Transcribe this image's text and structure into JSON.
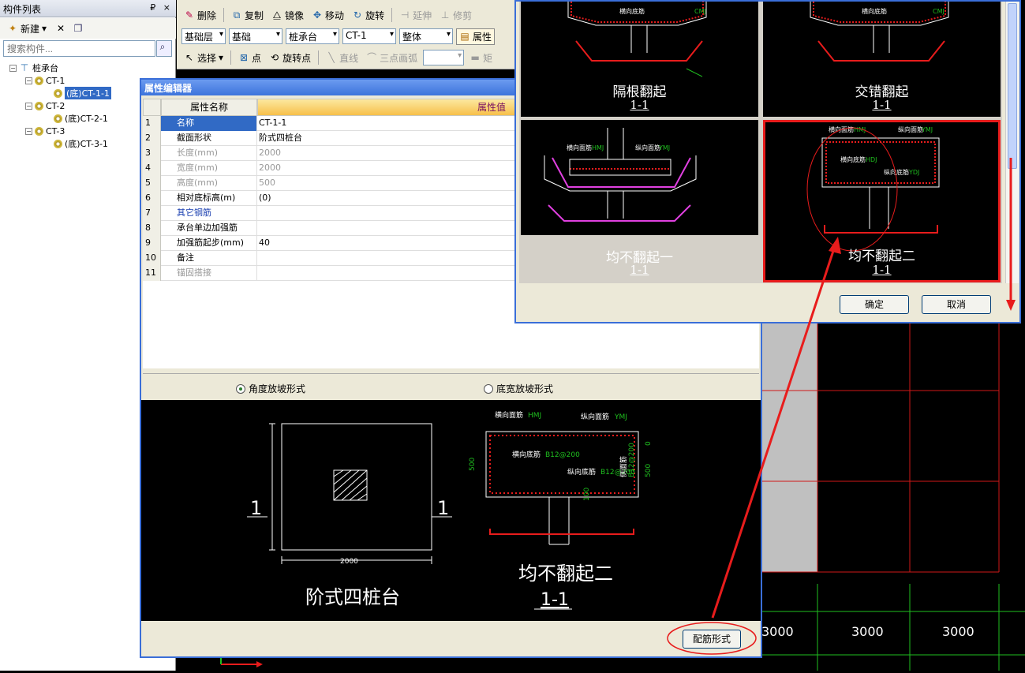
{
  "left_panel": {
    "title": "构件列表",
    "title_controls": "₽ ×",
    "new_label": "新建",
    "search_placeholder": "搜索构件...",
    "tree": {
      "root": "桩承台",
      "groups": [
        {
          "label": "CT-1",
          "child": "(底)CT-1-1"
        },
        {
          "label": "CT-2",
          "child": "(底)CT-2-1"
        },
        {
          "label": "CT-3",
          "child": "(底)CT-3-1"
        }
      ]
    }
  },
  "toolbar": {
    "row1": [
      "删除",
      "复制",
      "镜像",
      "移动",
      "旋转",
      "延伸",
      "修剪"
    ],
    "row2": {
      "floor": "基础层",
      "category": "基础",
      "type": "桩承台",
      "element": "CT-1",
      "scope": "整体",
      "properties": "属性"
    },
    "row3": [
      "选择",
      "点",
      "旋转点",
      "直线",
      "三点画弧",
      "矩"
    ]
  },
  "prop_editor": {
    "title": "属性编辑器",
    "col_name": "属性名称",
    "col_value": "属性值",
    "rows": [
      {
        "num": "1",
        "name": "名称",
        "value": "CT-1-1",
        "style": "selected"
      },
      {
        "num": "2",
        "name": "截面形状",
        "value": "阶式四桩台",
        "style": ""
      },
      {
        "num": "3",
        "name": "长度(mm)",
        "value": "2000",
        "style": "gray"
      },
      {
        "num": "4",
        "name": "宽度(mm)",
        "value": "2000",
        "style": "gray"
      },
      {
        "num": "5",
        "name": "高度(mm)",
        "value": "500",
        "style": "gray"
      },
      {
        "num": "6",
        "name": "相对底标高(m)",
        "value": "(0)",
        "style": ""
      },
      {
        "num": "7",
        "name": "其它钢筋",
        "value": "",
        "style": "blue"
      },
      {
        "num": "8",
        "name": "承台单边加强筋",
        "value": "",
        "style": ""
      },
      {
        "num": "9",
        "name": "加强筋起步(mm)",
        "value": "40",
        "style": ""
      },
      {
        "num": "10",
        "name": "备注",
        "value": "",
        "style": ""
      },
      {
        "num": "11",
        "name": "锚固搭接",
        "value": "",
        "style": "gray"
      }
    ],
    "radio_angle": "角度放坡形式",
    "radio_width": "底宽放坡形式",
    "preview": {
      "plan_name": "阶式四桩台",
      "plan_dim": "2000",
      "section_mark": "1",
      "section_name": "均不翻起二",
      "section_label": "1-1",
      "lbl_top_h": "横向面筋",
      "lbl_top_h_code": "HMJ",
      "lbl_top_v": "纵向面筋",
      "lbl_top_v_code": "YMJ",
      "lbl_bot_h": "横向底筋",
      "lbl_bot_h_code": "B12@200",
      "lbl_bot_v": "纵向底筋",
      "lbl_bot_v_code": "B12@200",
      "lbl_side": "侧面筋",
      "lbl_side_code": "B12@200",
      "dim_500": "500",
      "dim_100": "100",
      "dim_0": "0"
    },
    "rebar_button": "配筋形式"
  },
  "select_dialog": {
    "cells": [
      {
        "name": "隔根翻起",
        "section": "1-1"
      },
      {
        "name": "交错翻起",
        "section": "1-1"
      },
      {
        "name": "均不翻起一",
        "section": "1-1"
      },
      {
        "name": "均不翻起二",
        "section": "1-1"
      }
    ],
    "cell_labels": {
      "top_h": "横向面筋",
      "top_h_code": "HMJ",
      "top_v": "纵向面筋",
      "top_v_code": "YMJ",
      "bot_h": "横向底筋",
      "bot_h_code": "HDJ",
      "bot_v": "纵向底筋",
      "bot_v_code": "YDJ",
      "cmj": "CMJ"
    },
    "ok": "确定",
    "cancel": "取消"
  },
  "cad": {
    "dims": [
      "3000",
      "3000",
      "3000"
    ]
  },
  "colors": {
    "title_blue": "#3d74dc",
    "annot_red": "#e81c1c",
    "cad_green": "#1fbf1f",
    "cad_red": "#d01818"
  }
}
